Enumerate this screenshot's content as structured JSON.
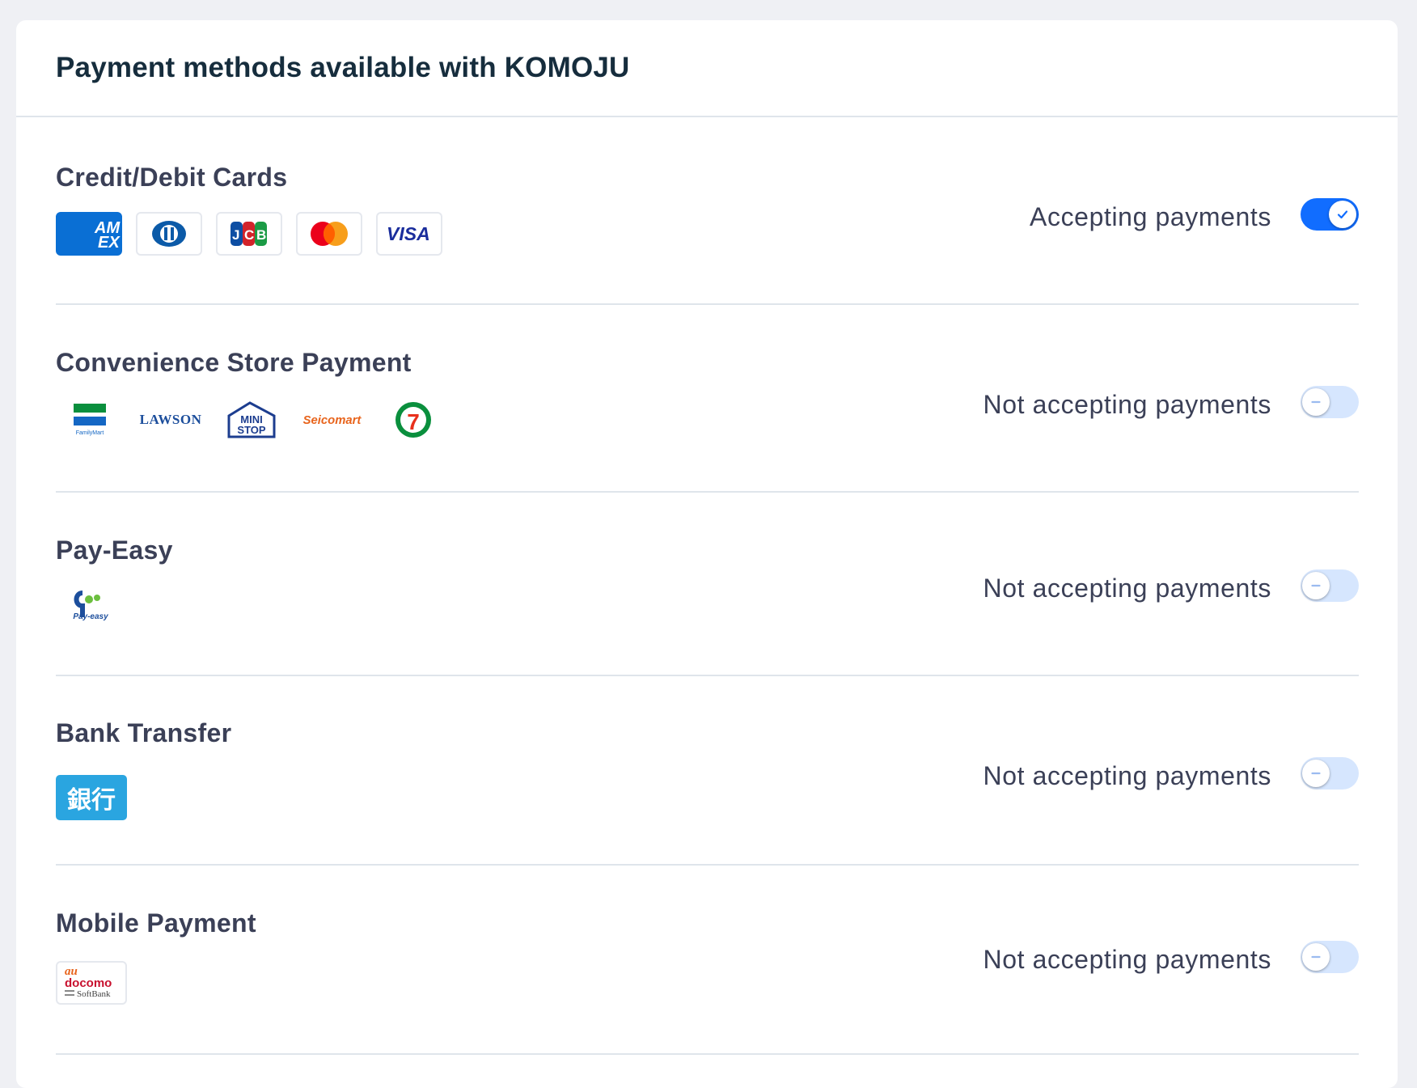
{
  "header": {
    "title": "Payment methods available with KOMOJU"
  },
  "sections": [
    {
      "title": "Credit/Debit Cards",
      "status": "Accepting payments",
      "enabled": true,
      "logos": [
        {
          "icon": "amex-logo",
          "text": "AM EX"
        },
        {
          "icon": "diners-club-logo"
        },
        {
          "icon": "jcb-logo",
          "text": "JCB"
        },
        {
          "icon": "mastercard-logo"
        },
        {
          "icon": "visa-logo",
          "text": "VISA"
        }
      ]
    },
    {
      "title": "Convenience Store Payment",
      "status": "Not accepting payments",
      "enabled": false,
      "logos": [
        {
          "icon": "familymart-logo",
          "text": "FamilyMart"
        },
        {
          "icon": "lawson-logo",
          "text": "LAWSON"
        },
        {
          "icon": "ministop-logo",
          "text": "MINI STOP"
        },
        {
          "icon": "seicomart-logo",
          "text": "Seicomart"
        },
        {
          "icon": "seven-eleven-logo",
          "text": "7"
        }
      ]
    },
    {
      "title": "Pay-Easy",
      "status": "Not accepting payments",
      "enabled": false,
      "logos": [
        {
          "icon": "pay-easy-logo",
          "text": "Pay-easy"
        }
      ]
    },
    {
      "title": "Bank Transfer",
      "status": "Not accepting payments",
      "enabled": false,
      "logos": [
        {
          "icon": "bank-logo",
          "text": "銀行"
        }
      ]
    },
    {
      "title": "Mobile Payment",
      "status": "Not accepting payments",
      "enabled": false,
      "logos": [
        {
          "icon": "carrier-logo",
          "text_au": "au",
          "text_docomo": "docomo",
          "text_softbank": "SoftBank"
        }
      ]
    }
  ],
  "colors": {
    "accent": "#116dff",
    "toggle_off": "#d6e6fe",
    "bank_blue": "#2aa5e0",
    "amex_blue": "#0a6fd4"
  }
}
